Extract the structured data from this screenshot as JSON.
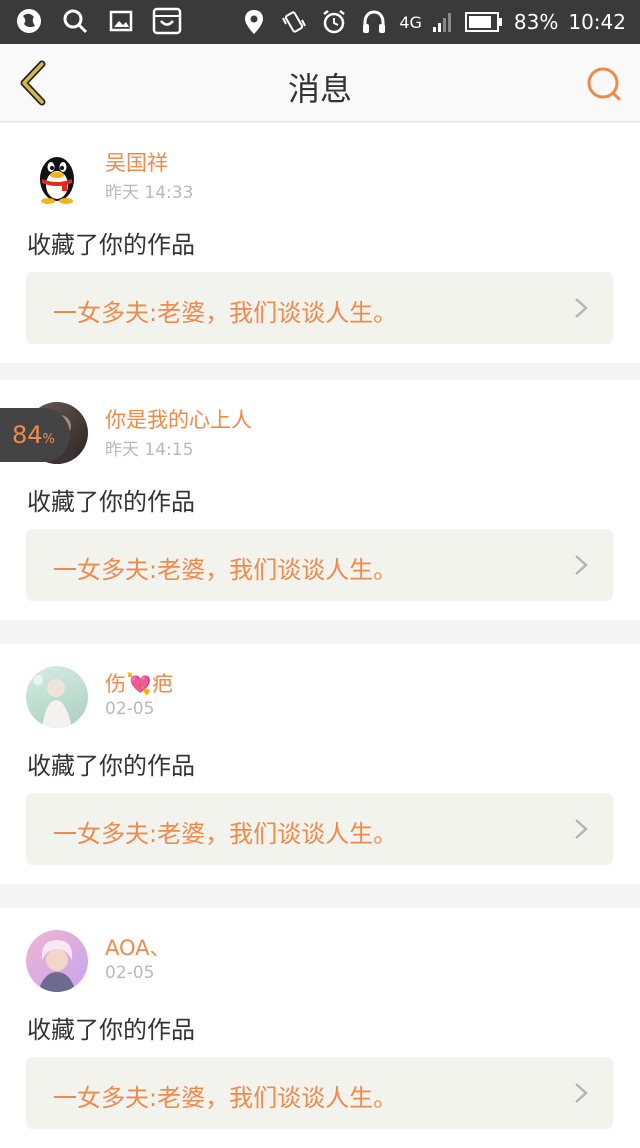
{
  "status": {
    "battery": "83%",
    "time": "10:42",
    "network": "4G"
  },
  "header": {
    "title": "消息"
  },
  "messages": [
    {
      "name": "吴国祥",
      "time": "昨天 14:33",
      "action": "收藏了你的作品",
      "work_title": "一女多夫:老婆，我们谈谈人生。"
    },
    {
      "name": "你是我的心上人",
      "time": "昨天 14:15",
      "action": "收藏了你的作品",
      "work_title": "一女多夫:老婆，我们谈谈人生。"
    },
    {
      "name": "伤💘疤",
      "time": "02-05",
      "action": "收藏了你的作品",
      "work_title": "一女多夫:老婆，我们谈谈人生。"
    },
    {
      "name": "AOA、",
      "time": "02-05",
      "action": "收藏了你的作品",
      "work_title": "一女多夫:老婆，我们谈谈人生。"
    }
  ],
  "overlay": {
    "percent": "84",
    "percent_sign": "%"
  },
  "colors": {
    "accent": "#f08a4b",
    "status_bar": "#3a3a3a",
    "back_icon": "#d6b94a"
  }
}
